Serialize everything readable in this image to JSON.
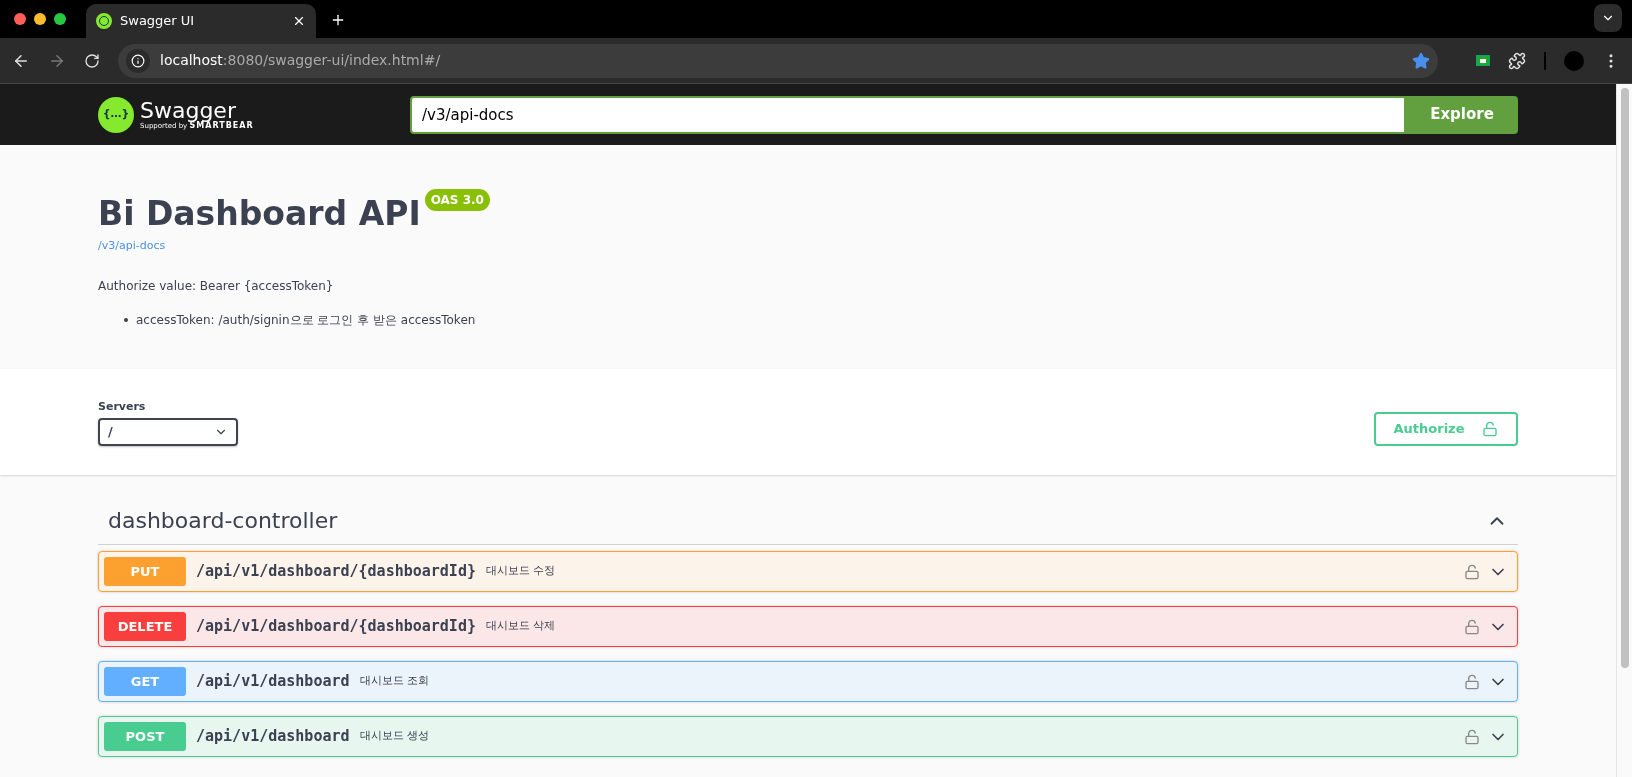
{
  "browser": {
    "tabs": [
      {
        "title": "Swagger UI",
        "selected": true
      }
    ],
    "url_host": "localhost",
    "url_path": ":8080/swagger-ui/index.html#/"
  },
  "topbar": {
    "logo_glyph": "{…}",
    "logo_text": "Swagger",
    "logo_sub": "Supported by",
    "logo_brand": "SMARTBEAR",
    "url_value": "/v3/api-docs",
    "explore_label": "Explore"
  },
  "info": {
    "title": "Bi Dashboard API",
    "version_badge": "OAS 3.0",
    "spec_link": "/v3/api-docs",
    "description": "Authorize value: Bearer {accessToken}",
    "bullets": [
      "accessToken: /auth/signin으로 로그인 후 받은 accessToken"
    ]
  },
  "servers": {
    "label": "Servers",
    "value": "/",
    "authorize_label": "Authorize"
  },
  "tag": {
    "name": "dashboard-controller",
    "expanded": true,
    "operations": [
      {
        "method": "PUT",
        "path": "/api/v1/dashboard/{dashboardId}",
        "summary": "대시보드 수정",
        "locked": false
      },
      {
        "method": "DELETE",
        "path": "/api/v1/dashboard/{dashboardId}",
        "summary": "대시보드 삭제",
        "locked": false
      },
      {
        "method": "GET",
        "path": "/api/v1/dashboard",
        "summary": "대시보드 조회",
        "locked": false
      },
      {
        "method": "POST",
        "path": "/api/v1/dashboard",
        "summary": "대시보드 생성",
        "locked": false
      }
    ]
  }
}
